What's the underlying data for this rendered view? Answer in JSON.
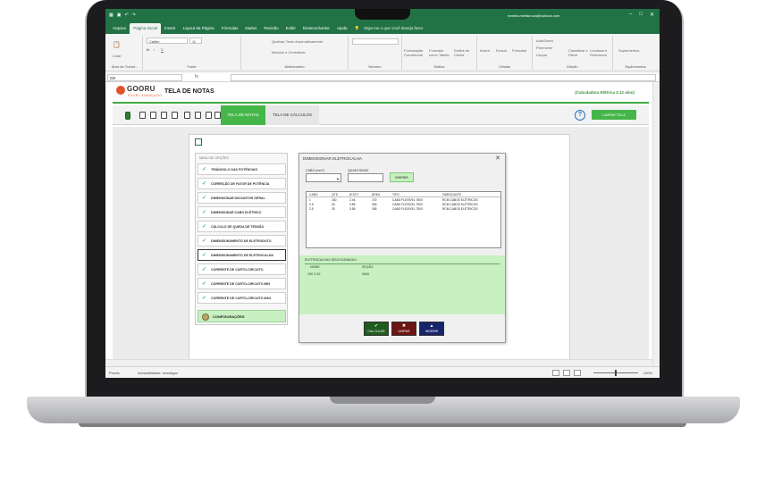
{
  "excel": {
    "user": "martha.melida.sza@outlook.com",
    "tabs": [
      "Arquivo",
      "Página Inicial",
      "Inserir",
      "Layout da Página",
      "Fórmulas",
      "Dados",
      "Revisão",
      "Exibir",
      "Desenvolvedor",
      "Ajuda"
    ],
    "active_tab": "Página Inicial",
    "tell_me": "Diga-me o que você deseja fazer",
    "font_name": "Calibri",
    "font_size": "11",
    "paste_label": "Colar",
    "groups": {
      "clipboard": "Área de Transf...",
      "font": "Fonte",
      "alignment": "Alinhamento",
      "number": "Número",
      "styles": "Estilos",
      "cells": "Células",
      "editing": "Edição",
      "addins": "Suplementos"
    },
    "ribbon_bits": {
      "wrap_text": "Quebrar Texto Automaticamente",
      "merge": "Mesclar e Centralizar",
      "cond_format": "Formatação Condicional",
      "format_table": "Formatar como Tabela",
      "cell_styles": "Estilos de Célula",
      "insert": "Inserir",
      "delete": "Excluir",
      "format": "Formatar",
      "autosum": "AutoSoma",
      "fill": "Preencher",
      "clear": "Limpar",
      "sort": "Classificar e Filtrar",
      "find": "Localizar e Selecionar",
      "addins": "Suplementos"
    },
    "name_box": "C9",
    "fx": "fx"
  },
  "app": {
    "logo": "GOORU",
    "logo_sub": "EXCEL AVANÇADO",
    "title": "TELA DE NOTAS",
    "version": "(Calculadora Elétrica 2.12 alon)",
    "tab_notas": "TELA DE NOTAS",
    "tab_calculos": "TELA DE CÁLCULOS",
    "help": "?",
    "clear_screen": "LIMPAR TELA"
  },
  "menu": {
    "title": "MENU DE OPÇÕES",
    "items": [
      "TRIÂNGULO DAS POTÊNCIAS",
      "CORREÇÃO DE FATOR DE POTÊNCIA",
      "DIMENSIONAR DISJUNTOR GERAL",
      "DIMENSIONAR CABO ELÉTRICO",
      "CÁLCULO DE QUEDA DE TENSÃO",
      "DIMENSIONAMENTO DE ELETRODUTO",
      "DIMENSIONAMENTO DE ELETROCALHA",
      "CORRENTE DE CURTO-CIRCUITO",
      "CORRENTE DE CURTO-CIRCUITO  MÍN",
      "CORRENTE DE CURTO-CIRCUITO MÁX"
    ],
    "config": "CONFIGURAÇÕES"
  },
  "dialog": {
    "title": "DIMENSIONAR ELETROCALHA",
    "close": "✕",
    "cable_label": "CABO (mm²)",
    "qty_label": "QUANTIDADE",
    "insert_btn": "INSERIR",
    "columns": [
      "CABO",
      "QTD",
      "Ø EXT",
      "ÁREA",
      "TIPO",
      "FABRICANTE"
    ],
    "rows": [
      [
        "1",
        "150",
        "2.46",
        "720",
        "CABO FLEXÍVEL 750V",
        "RCM CABOS ELÉTRICOS"
      ],
      [
        "2.5",
        "30",
        "3.58",
        "305",
        "CABO FLEXÍVEL 750V",
        "RCM CABOS ELÉTRICOS"
      ],
      [
        "2.5",
        "30",
        "3.58",
        "305",
        "CABO FLEXÍVEL 750V",
        "RCM CABOS ELÉTRICOS"
      ]
    ],
    "result_title": "ELETROCALHAS SELECIONADAS",
    "result_col_name": "NOME",
    "result_col_section": "SEÇÃO",
    "result_name": "100 X 50",
    "result_section": "5000",
    "btn_calc": "CALCULAR",
    "btn_clear": "LIMPAR",
    "btn_insert": "INSERIR"
  },
  "status": {
    "ready": "Pronto",
    "accessibility": "Acessibilidade: investigar",
    "zoom": "100%"
  }
}
